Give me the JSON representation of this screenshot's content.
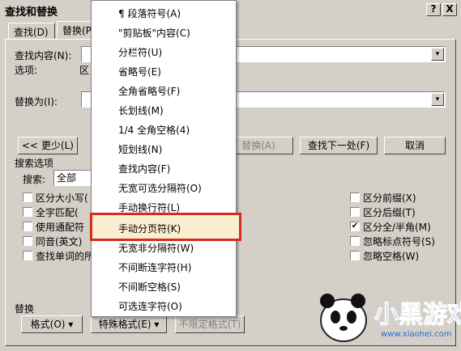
{
  "dialog": {
    "title": "查找和替换",
    "help_btn": "?",
    "close_btn": "X"
  },
  "tabs": {
    "find": "查找(D)",
    "replace": "替换(P)"
  },
  "find": {
    "label": "查找内容(N):",
    "options_label": "选项:",
    "options_value": "区"
  },
  "replace": {
    "label": "替换为(I):"
  },
  "buttons": {
    "less": "<< 更少(L)",
    "replace": "替换(A)",
    "find_next": "查找下一处(F)",
    "cancel": "取消",
    "format": "格式(O) ▾",
    "special": "特殊格式(E) ▾",
    "no_format": "不限定格式(T)"
  },
  "search": {
    "section": "搜索选项",
    "label": "搜索:",
    "value": "全部"
  },
  "checks_left": [
    {
      "label": "区分大小写(",
      "checked": false
    },
    {
      "label": "全字匹配(",
      "checked": false
    },
    {
      "label": "使用通配符",
      "checked": false
    },
    {
      "label": "同音(英文)",
      "checked": false
    },
    {
      "label": "查找单词的所",
      "checked": false
    }
  ],
  "checks_right": [
    {
      "label": "区分前缀(X)",
      "checked": false
    },
    {
      "label": "区分后缀(T)",
      "checked": false
    },
    {
      "label": "区分全/半角(M)",
      "checked": true
    },
    {
      "label": "忽略标点符号(S)",
      "checked": false
    },
    {
      "label": "忽略空格(W)",
      "checked": false
    }
  ],
  "replace_section": "替换",
  "menu": {
    "items": [
      "¶ 段落符号(A)",
      "\"剪贴板\"内容(C)",
      "分栏符(U)",
      "省略号(E)",
      "全角省略号(F)",
      "长划线(M)",
      "1/4 全角空格(4)",
      "短划线(N)",
      "查找内容(F)",
      "无宽可选分隔符(O)",
      "手动换行符(L)",
      "手动分页符(K)",
      "无宽非分隔符(W)",
      "不间断连字符(H)",
      "不间断空格(S)",
      "可选连字符(O)"
    ],
    "highlight_index": 11,
    "highlight_color": "#d42a1f"
  },
  "watermark": {
    "text": "小黑游戏",
    "url": "www.xiaohei.com"
  }
}
